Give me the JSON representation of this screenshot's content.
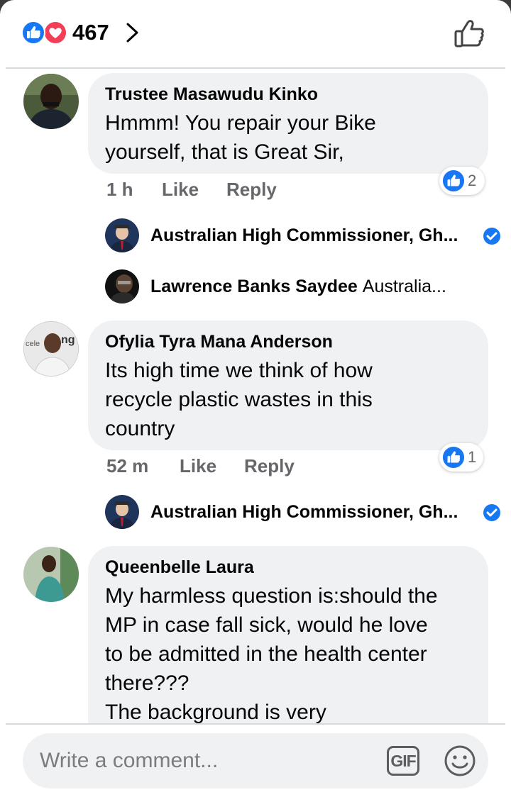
{
  "header": {
    "reaction_count": "467",
    "reaction_icons": [
      "like-icon",
      "love-icon"
    ],
    "like_icon": "thumbs-up-outline-icon"
  },
  "comments": [
    {
      "author": "Trustee Masawudu Kinko",
      "text_lines": [
        "Hmmm! You repair your Bike",
        "yourself, that is Great Sir,"
      ],
      "time": "1 h",
      "like_label": "Like",
      "reply_label": "Reply",
      "reaction_count": "2",
      "replies": [
        {
          "name": "Australian High Commissioner, Gh...",
          "text": "",
          "verified": true
        },
        {
          "name": "Lawrence Banks Saydee",
          "text": "Australia...",
          "verified": false
        }
      ]
    },
    {
      "author": "Ofylia Tyra Mana Anderson",
      "text_lines": [
        "Its high time we think of how",
        "recycle plastic wastes in this",
        "country"
      ],
      "time": "52 m",
      "like_label": "Like",
      "reply_label": "Reply",
      "reaction_count": "1",
      "avatar_text": "celeb ng D",
      "replies": [
        {
          "name": "Australian High Commissioner, Gh...",
          "text": "",
          "verified": true
        }
      ]
    },
    {
      "author": "Queenbelle Laura",
      "text_lines": [
        "My harmless question is:should the",
        "MP in case fall sick, would he  love",
        "to be admitted in the health center",
        "there???",
        "The background is very"
      ]
    }
  ],
  "composer": {
    "placeholder": "Write a comment...",
    "gif_label": "GIF",
    "emoji_icon": "smiley-icon"
  },
  "colors": {
    "facebook_blue": "#1877f2",
    "love_red": "#f33e58",
    "bubble_bg": "#eff1f3",
    "meta_gray": "#65676b"
  }
}
